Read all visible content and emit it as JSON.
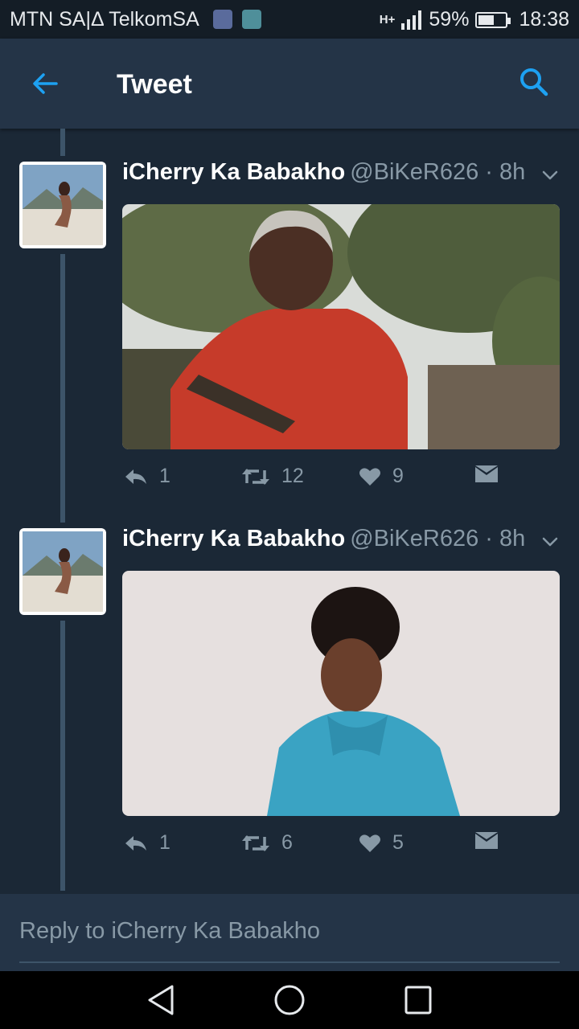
{
  "status_bar": {
    "carrier": "MTN SA|Δ TelkomSA",
    "network": "H+",
    "battery_percent": "59%",
    "battery_level": 0.59,
    "time": "18:38"
  },
  "app_bar": {
    "title": "Tweet",
    "back_icon": "arrow-left-icon",
    "search_icon": "search-icon"
  },
  "tweets": [
    {
      "display_name": "iCherry Ka Babakho",
      "handle_time": "@BiKeR626 · 8h",
      "media": "photo of older woman in red patterned dress holding a rifle outdoors",
      "actions": {
        "replies": "1",
        "retweets": "12",
        "likes": "9"
      }
    },
    {
      "display_name": "iCherry Ka Babakho",
      "handle_time": "@BiKeR626 · 8h",
      "media": "photo of young woman in blue patterned blouse against light background",
      "actions": {
        "replies": "1",
        "retweets": "6",
        "likes": "5"
      }
    }
  ],
  "reply_bar": {
    "placeholder": "Reply to iCherry Ka Babakho"
  },
  "colors": {
    "background": "#1b2836",
    "app_bar": "#243447",
    "accent": "#1da1f2",
    "secondary_text": "#8899a6"
  }
}
